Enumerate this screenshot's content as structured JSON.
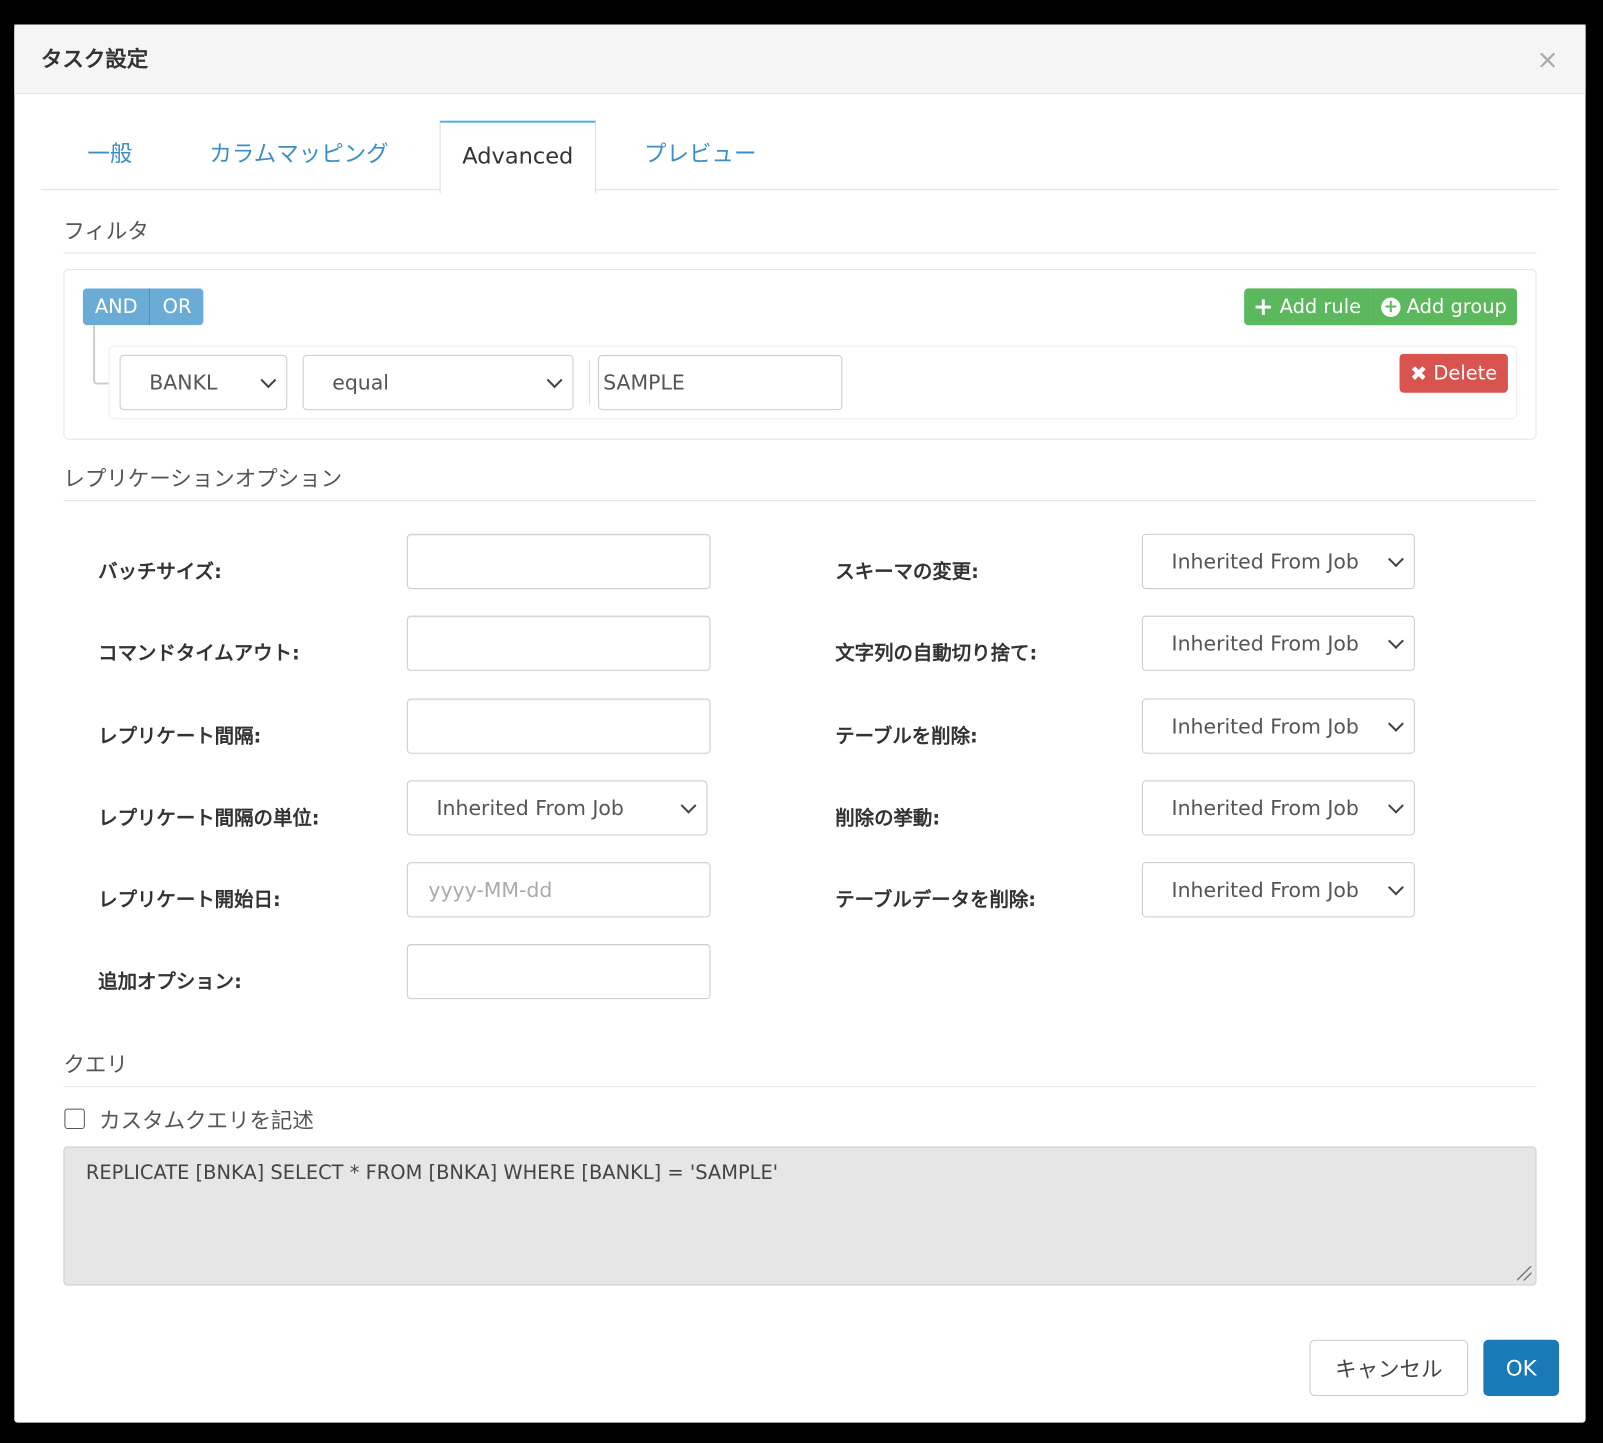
{
  "dialog": {
    "title": "タスク設定",
    "close_label": "×"
  },
  "tabs": [
    {
      "label": "一般",
      "active": false
    },
    {
      "label": "カラムマッピング",
      "active": false
    },
    {
      "label": "Advanced",
      "active": true
    },
    {
      "label": "プレビュー",
      "active": false
    }
  ],
  "filter": {
    "heading": "フィルタ",
    "and_label": "AND",
    "or_label": "OR",
    "add_rule_label": "Add rule",
    "add_group_label": "Add group",
    "rule": {
      "field": "BANKL",
      "operator": "equal",
      "value": "SAMPLE",
      "delete_label": "Delete"
    }
  },
  "replication": {
    "heading": "レプリケーションオプション",
    "left": [
      {
        "label": "バッチサイズ:",
        "value": ""
      },
      {
        "label": "コマンドタイムアウト:",
        "value": ""
      },
      {
        "label": "レプリケート間隔:",
        "value": ""
      },
      {
        "label": "レプリケート間隔の単位:",
        "value": "Inherited From Job"
      },
      {
        "label": "レプリケート開始日:",
        "placeholder": "yyyy-MM-dd"
      },
      {
        "label": "追加オプション:",
        "value": ""
      }
    ],
    "right": [
      {
        "label": "スキーマの変更:",
        "value": "Inherited From Job"
      },
      {
        "label": "文字列の自動切り捨て:",
        "value": "Inherited From Job"
      },
      {
        "label": "テーブルを削除:",
        "value": "Inherited From Job"
      },
      {
        "label": "削除の挙動:",
        "value": "Inherited From Job"
      },
      {
        "label": "テーブルデータを削除:",
        "value": "Inherited From Job"
      }
    ]
  },
  "query": {
    "heading": "クエリ",
    "custom_label": "カスタムクエリを記述",
    "custom_checked": false,
    "text": "REPLICATE [BNKA] SELECT * FROM [BNKA] WHERE [BANKL] = 'SAMPLE'"
  },
  "footer": {
    "cancel_label": "キャンセル",
    "ok_label": "OK"
  },
  "colors": {
    "primary": "#1a7ab8",
    "success": "#5cb85c",
    "danger": "#d9534f",
    "info": "#6aacd6",
    "tab_link": "#3a8fc8"
  }
}
